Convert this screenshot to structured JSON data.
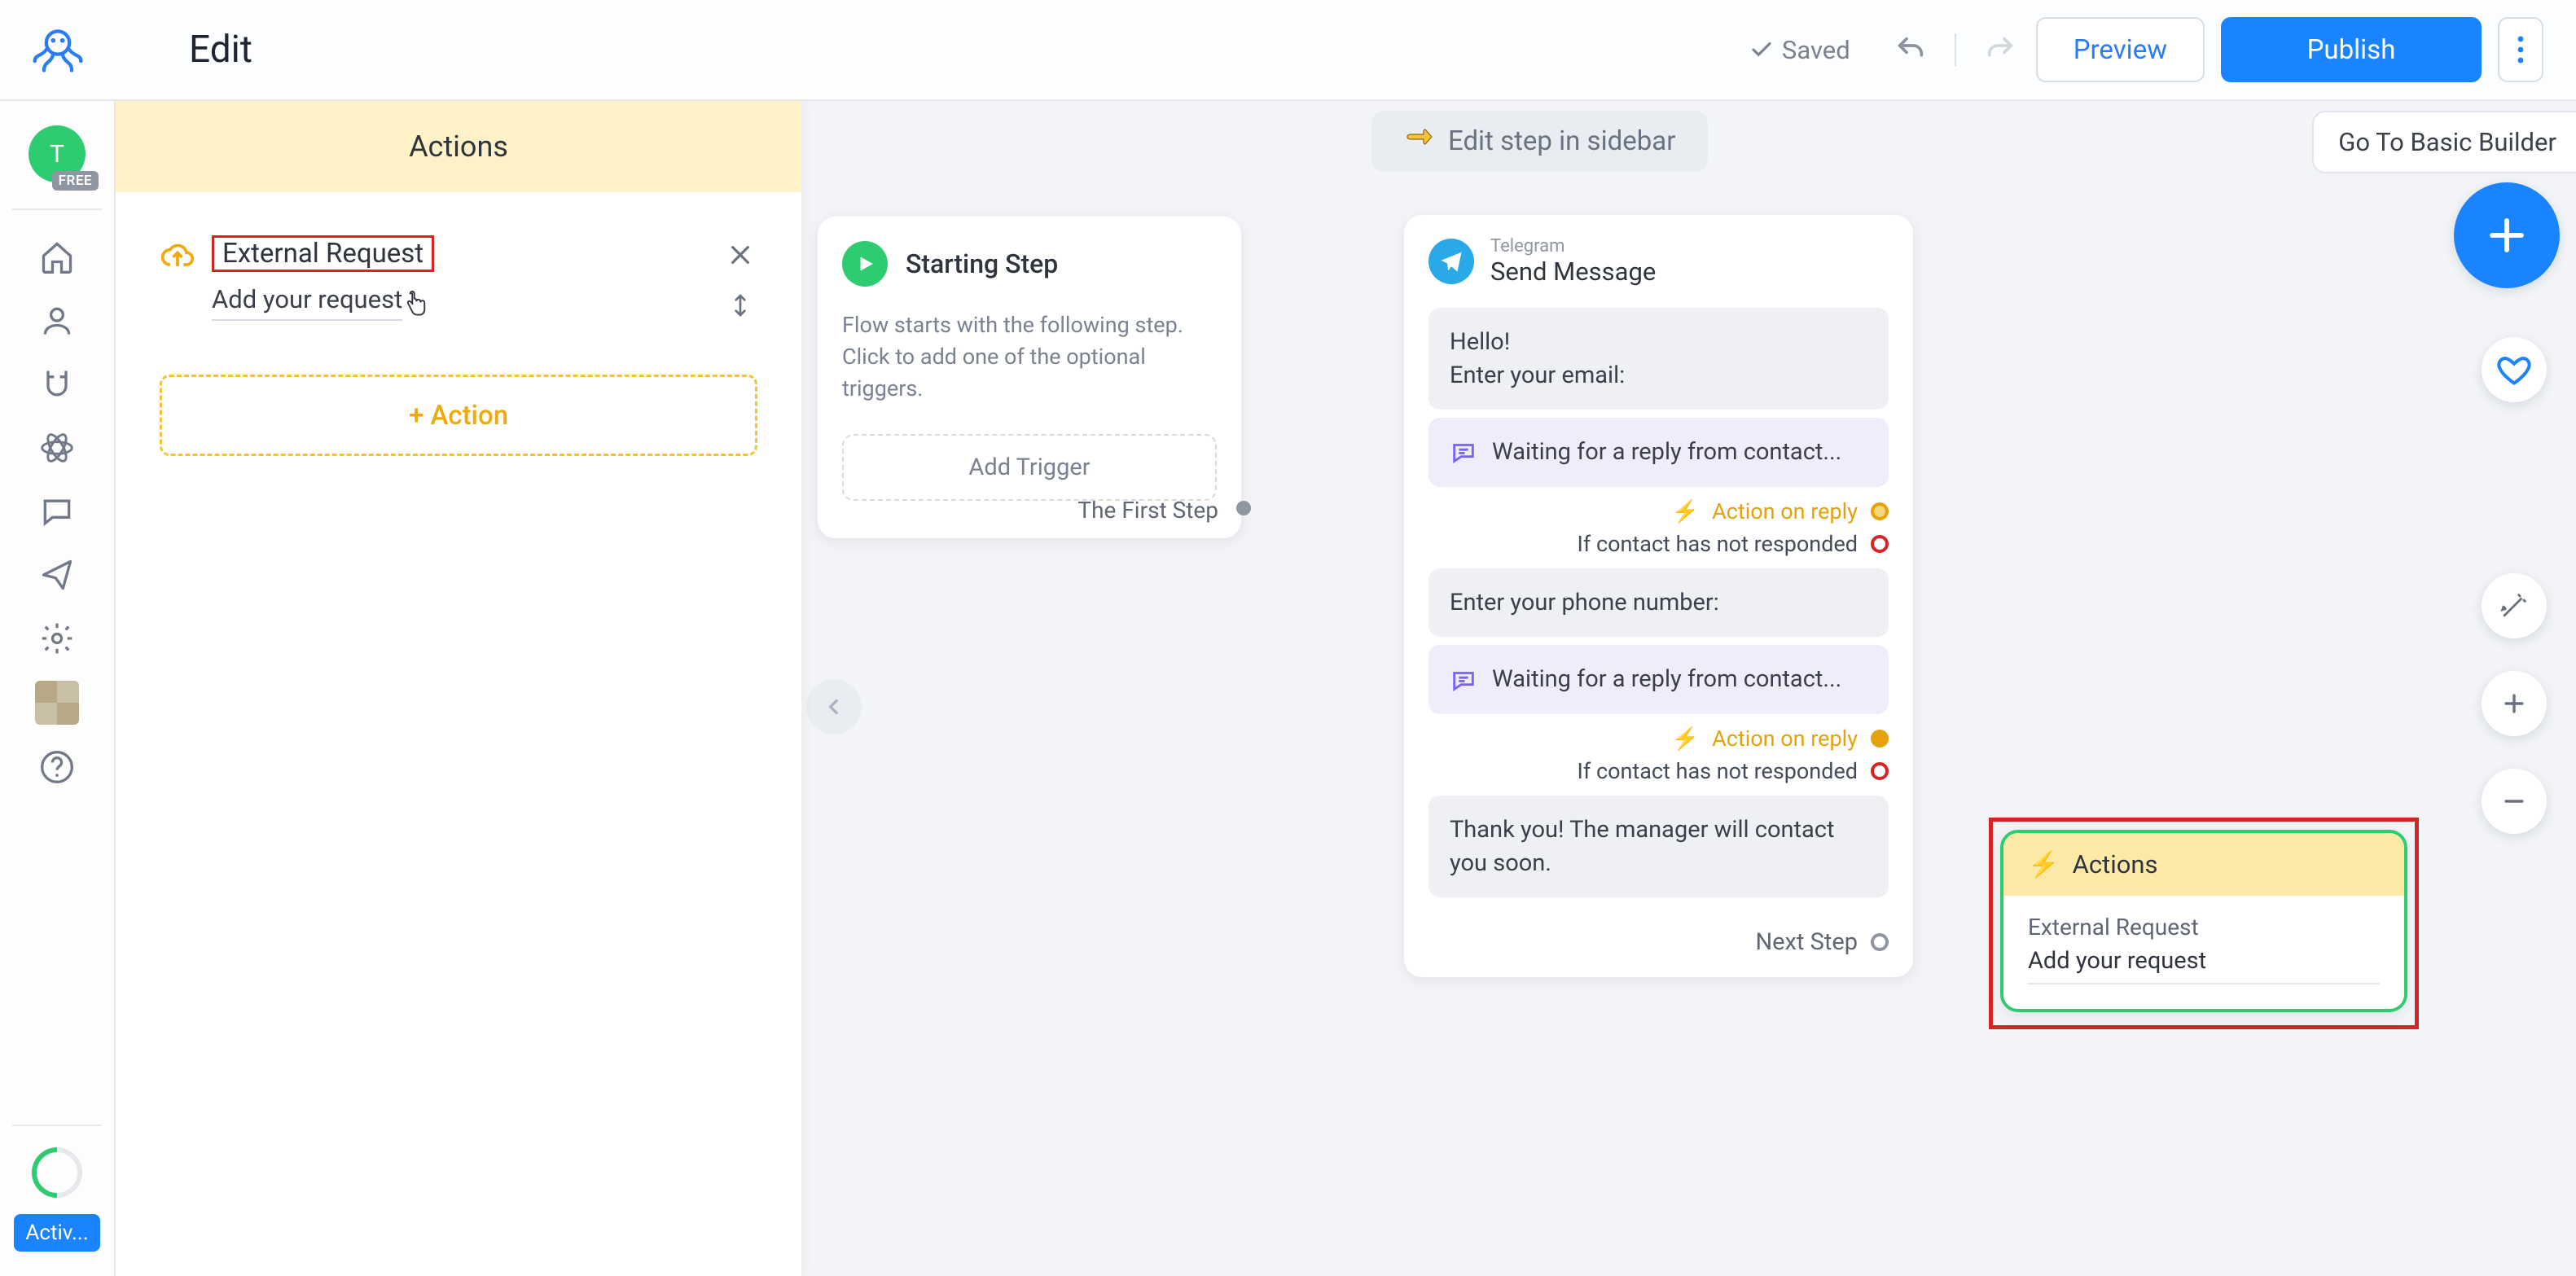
{
  "header": {
    "title": "Edit",
    "saved": "Saved",
    "preview": "Preview",
    "publish": "Publish"
  },
  "leftRail": {
    "avatarLetter": "T",
    "freeBadge": "FREE",
    "activ": "Activ..."
  },
  "sidebar": {
    "heading": "Actions",
    "externalRequest": "External Request",
    "addYourRequest": "Add your request",
    "addAction": "+ Action"
  },
  "canvas": {
    "editStep": "Edit step in sidebar",
    "goBasic": "Go To Basic Builder",
    "start": {
      "title": "Starting Step",
      "line1": "Flow starts with the following step.",
      "line2": "Click to add one of the optional triggers.",
      "addTrigger": "Add Trigger",
      "firstStep": "The First Step"
    },
    "msg": {
      "platform": "Telegram",
      "title": "Send Message",
      "hello": "Hello!",
      "enterEmail": "Enter your email:",
      "waiting": "Waiting for a reply from contact...",
      "actionOnReply": "Action on reply",
      "noResponse": "If contact has not responded",
      "enterPhone": "Enter your phone number:",
      "thankyou": "Thank you! The manager will contact you soon.",
      "nextStep": "Next Step"
    },
    "actionsCard": {
      "title": "Actions",
      "line1": "External Request",
      "line2": "Add your request"
    }
  }
}
